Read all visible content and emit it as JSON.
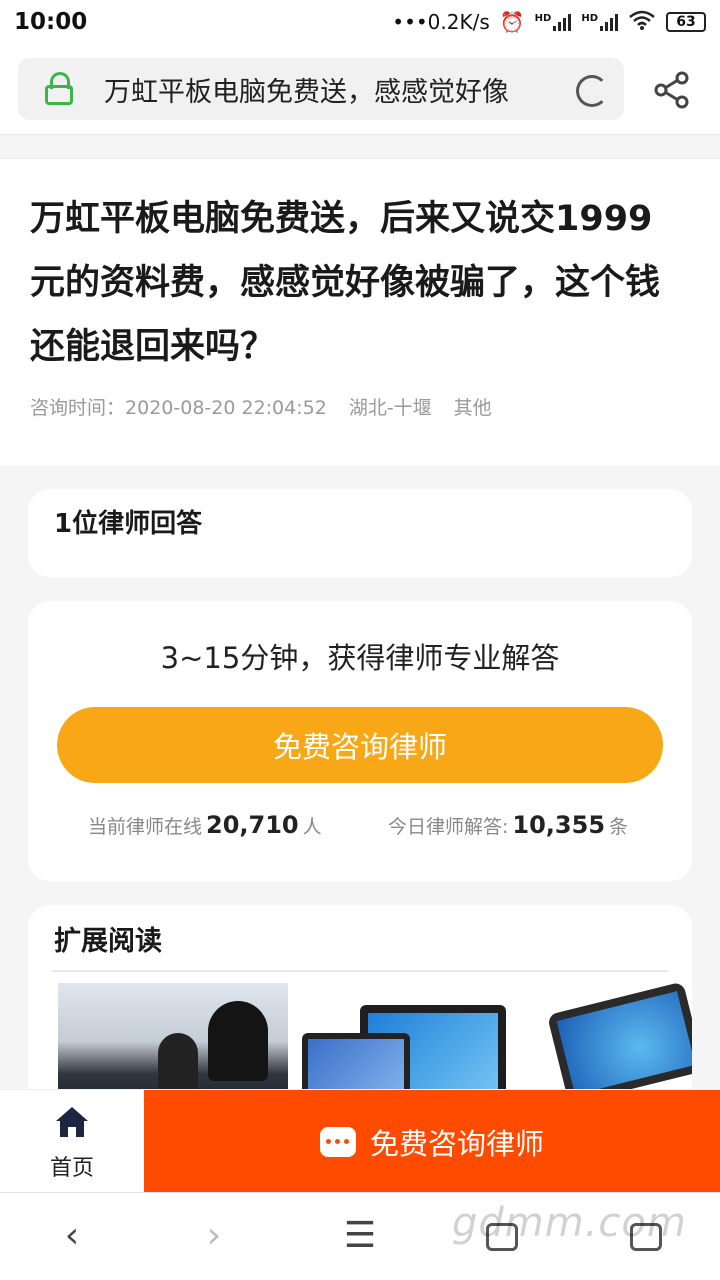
{
  "status_bar": {
    "time": "10:00",
    "network_speed": "0.2K/s",
    "hd_label_1": "HD",
    "hd_label_2": "HD",
    "battery": "63"
  },
  "browser": {
    "url_title": "万虹平板电脑免费送，感感觉好像"
  },
  "article": {
    "title": "万虹平板电脑免费送，后来又说交1999元的资料费，感感觉好像被骗了，这个钱还能退回来吗？",
    "consult_time_label": "咨询时间：",
    "consult_time": "2020-08-20 22:04:52",
    "location": "湖北-十堰",
    "category": "其他"
  },
  "answers": {
    "title": "1位律师回答"
  },
  "consult": {
    "headline": "3~15分钟，获得律师专业解答",
    "button_label": "免费咨询律师",
    "online_label": "当前律师在线",
    "online_count": "20,710",
    "online_unit": "人",
    "today_label": "今日律师解答:",
    "today_count": "10,355",
    "today_unit": "条"
  },
  "reading": {
    "title": "扩展阅读"
  },
  "action_bar": {
    "home_label": "首页",
    "cta_label": "免费咨询律师"
  },
  "nav": {
    "back": "‹",
    "forward": "›",
    "menu": "☰"
  },
  "watermark": "gdmm.com",
  "colors": {
    "accent_orange": "#f8a816",
    "cta_red": "#ff4b00",
    "lock_green": "#3bb54a"
  }
}
